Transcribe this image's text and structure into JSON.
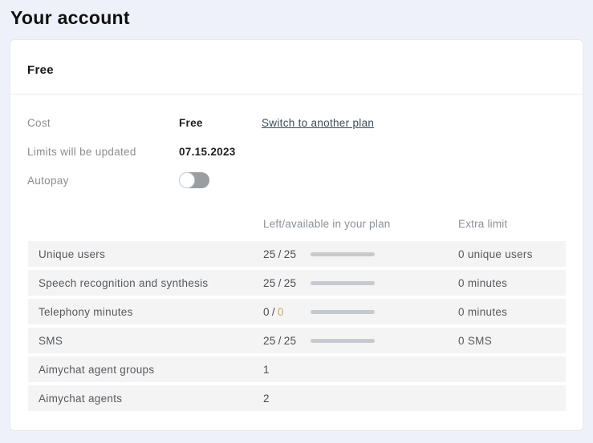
{
  "page": {
    "title": "Your account"
  },
  "card": {
    "plan_name": "Free",
    "details": {
      "cost": {
        "label": "Cost",
        "value": "Free",
        "link": "Switch to another plan"
      },
      "limits": {
        "label": "Limits will be updated",
        "value": "07.15.2023"
      },
      "autopay": {
        "label": "Autopay",
        "state": "off"
      }
    },
    "table": {
      "headers": {
        "left": "Left/available in your plan",
        "extra": "Extra limit"
      },
      "separator": "/",
      "rows": [
        {
          "label": "Unique users",
          "used": "25",
          "total": "25",
          "extra": "0 unique users"
        },
        {
          "label": "Speech recognition and synthesis",
          "used": "25",
          "total": "25",
          "extra": "0 minutes"
        },
        {
          "label": "Telephony minutes",
          "used": "0",
          "total": "0",
          "extra": "0 minutes"
        },
        {
          "label": "SMS",
          "used": "25",
          "total": "25",
          "extra": "0 SMS"
        },
        {
          "label": "Aimychat agent groups",
          "used": "1"
        },
        {
          "label": "Aimychat agents",
          "used": "2"
        }
      ]
    }
  },
  "colors": {
    "page_background": "#eef1fa",
    "card_background": "#ffffff",
    "row_background": "#f4f4f4",
    "highlight_total": "#d9a05b",
    "toggle_off": "#9b9ea1"
  }
}
